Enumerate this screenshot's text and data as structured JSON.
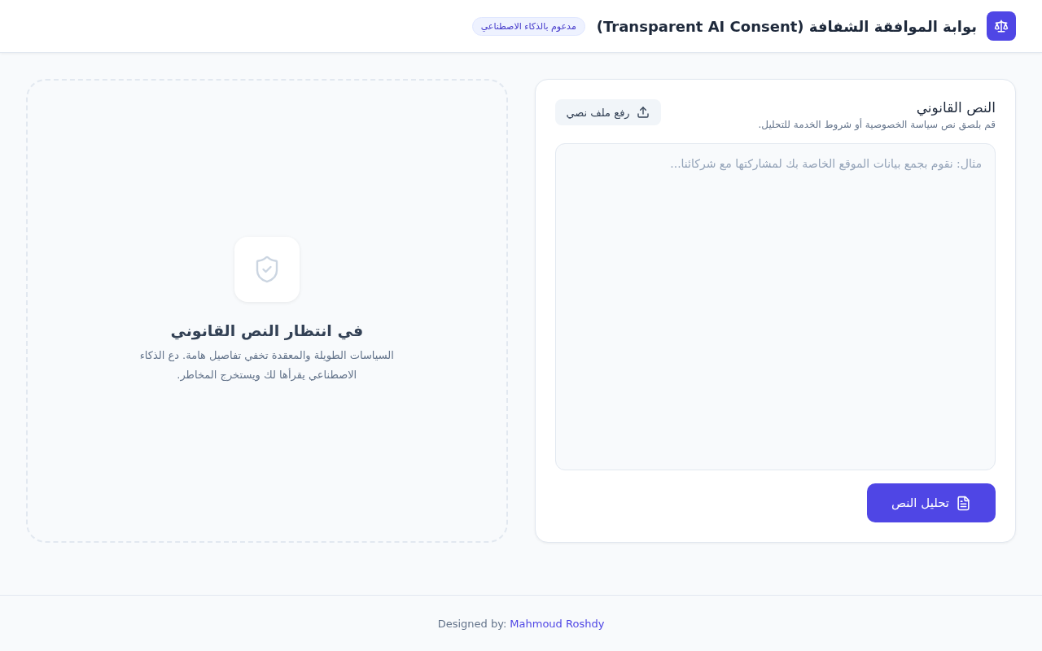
{
  "header": {
    "title": "بوابة الموافقة الشفافة (Transparent AI Consent)",
    "badge": "مدعوم بالذكاء الاصطناعي"
  },
  "input_card": {
    "title": "النص القانوني",
    "subtitle": "قم بلصق نص سياسة الخصوصية أو شروط الخدمة للتحليل.",
    "upload_button": "رفع ملف نصي",
    "textarea": {
      "placeholder": "مثال: نقوم بجمع بيانات الموقع الخاصة بك لمشاركتها مع شركائنا..."
    },
    "analyze_button": "تحليل النص"
  },
  "result_panel": {
    "title": "في انتظار النص القانوني",
    "description": "السياسات الطويلة والمعقدة تخفي تفاصيل هامة. دع الذكاء الاصطناعي يقرأها لك ويستخرج المخاطر."
  },
  "footer": {
    "label": "Designed by:",
    "link": "Mahmoud Roshdy"
  }
}
